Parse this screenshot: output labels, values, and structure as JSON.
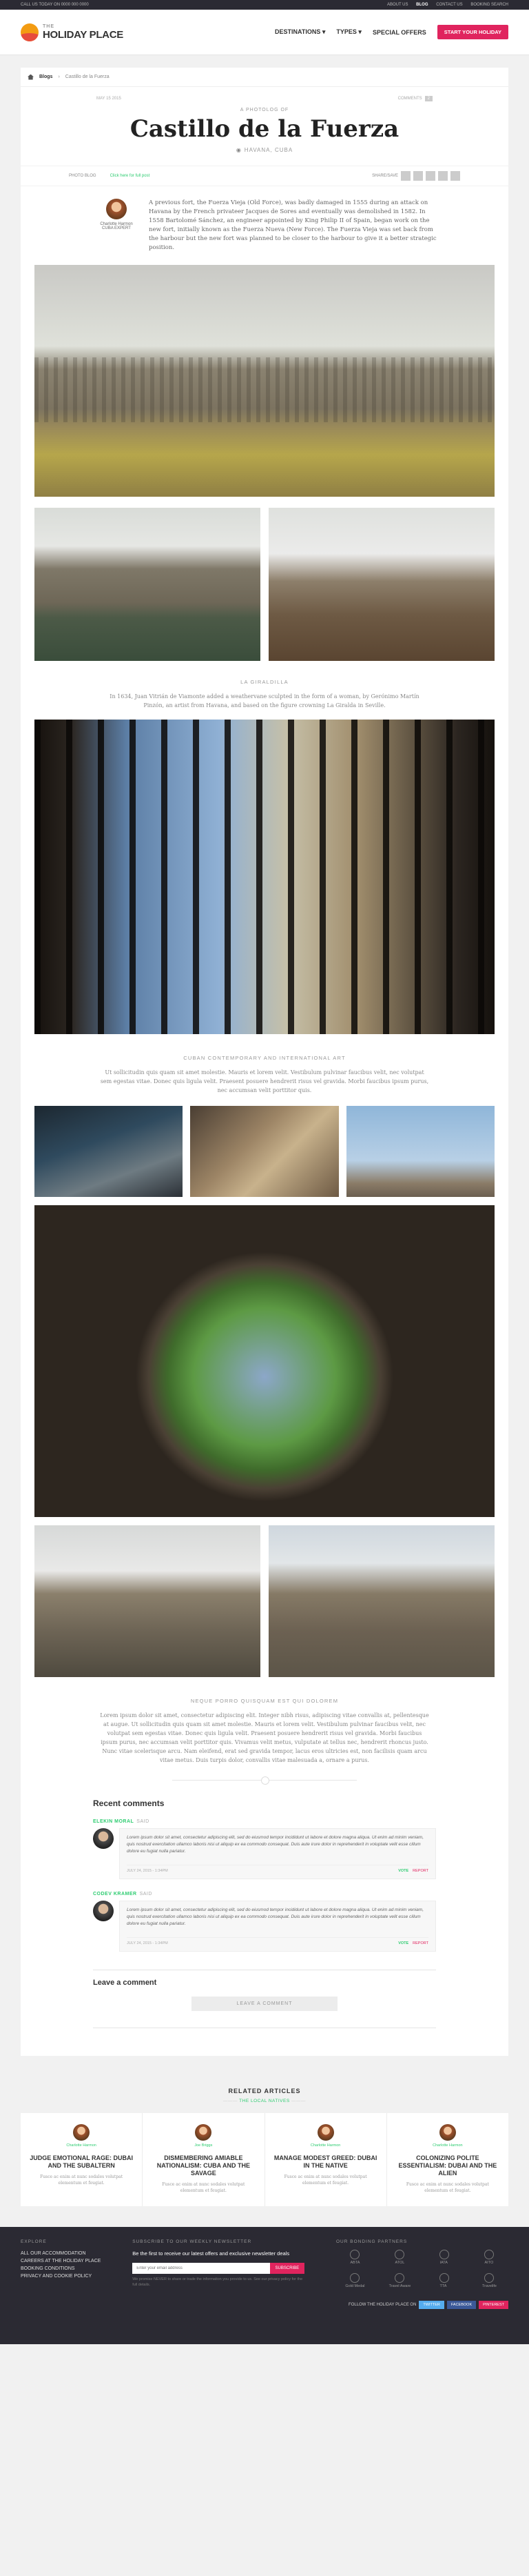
{
  "topbar": {
    "left": "CALL US TODAY ON 0000 000 0000",
    "links": [
      "ABOUT US",
      "BLOG",
      "CONTACT US",
      "BOOKING SEARCH"
    ]
  },
  "header": {
    "logo_main": "HOLIDAY PLACE",
    "logo_the": "THE",
    "nav": [
      "DESTINATIONS",
      "TYPES",
      "SPECIAL OFFERS"
    ],
    "cta": "START YOUR HOLIDAY"
  },
  "breadcrumb": {
    "blogs": "Blogs",
    "current": "Castillo de la Fuerza"
  },
  "article": {
    "date": "MAY 15 2015",
    "comments_label": "COMMENTS",
    "comments_count": "2",
    "kicker": "A PHOTOLOG OF",
    "title": "Castillo de la Fuerza",
    "location": "HAVANA, CUBA",
    "type_label": "PHOTO BLOG",
    "more_link": "Click here for full post",
    "share_label": "SHARE/SAVE",
    "author_name": "Charlotte Harmon",
    "author_role": "CUBA EXPERT",
    "intro": "A previous fort, the Fuerza Vieja (Old Force), was badly damaged in 1555 during an attack on Havana by the French privateer Jacques de Sores and eventually was demolished in 1582. In 1558 Bartolomé Sánchez, an engineer appointed by King Philip II of Spain, began work on the new fort, initially known as the Fuerza Nueva (New Force). The Fuerza Vieja was set back from the harbour but the new fort was planned to be closer to the harbour to give it a better strategic position."
  },
  "sections": [
    {
      "caption": "LA GIRALDILLA",
      "text": "In 1634, Juan Vitrián de Viamonte added a weathervane sculpted in the form of a woman, by Gerónimo Martín Pinzón, an artist from Havana, and based on the figure crowning La Giralda in Seville."
    },
    {
      "caption": "CUBAN CONTEMPORARY AND INTERNATIONAL ART",
      "text": "Ut sollicitudin quis quam sit amet molestie. Mauris et lorem velit. Vestibulum pulvinar faucibus velit, nec volutpat sem egestas vitae. Donec quis ligula velit. Praesent posuere hendrerit risus vel gravida. Morbi faucibus ipsum purus, nec accumsan velit porttitor quis."
    },
    {
      "caption": "NEQUE PORRO QUISQUAM EST QUI DOLOREM",
      "text": "Lorem ipsum dolor sit amet, consectetur adipiscing elit. Integer nibh risus, adipiscing vitae convallis at, pellentesque at augue. Ut sollicitudin quis quam sit amet molestie. Mauris et lorem velit. Vestibulum pulvinar faucibus velit, nec volutpat sem egestas vitae. Donec quis ligula velit. Praesent posuere hendrerit risus vel gravida. Morbi faucibus ipsum purus, nec accumsan velit porttitor quis. Vivamus velit metus, vulputate at tellus nec, hendrerit rhoncus justo. Nunc vitae scelerisque arcu. Nam eleifend, erat sed gravida tempor, lacus eros ultricies est, non facilisis quam arcu vitae metus. Duis turpis dolor, convallis vitae malesuada a, ornare a purus."
    }
  ],
  "comments": {
    "title": "Recent comments",
    "items": [
      {
        "name": "ELEKIN MORAL",
        "when": "SAID",
        "text": "Lorem ipsum dolor sit amet, consectetur adipiscing elit, sed do eiusmod tempor incididunt ut labore et dolore magna aliqua. Ut enim ad minim veniam, quis nostrud exercitation ullamco laboris nisi ut aliquip ex ea commodo consequat. Duis aute irure dolor in reprehenderit in voluptate velit esse cillum dolore eu fugiat nulla pariatur.",
        "date": "JULY 24, 2015 - 1:34PM",
        "up": "VOTE",
        "down": "REPORT"
      },
      {
        "name": "CODEV KRAMER",
        "when": "SAID",
        "text": "Lorem ipsum dolor sit amet, consectetur adipiscing elit, sed do eiusmod tempor incididunt ut labore et dolore magna aliqua. Ut enim ad minim veniam, quis nostrud exercitation ullamco laboris nisi ut aliquip ex ea commodo consequat. Duis aute irure dolor in reprehenderit in voluptate velit esse cillum dolore eu fugiat nulla pariatur.",
        "date": "JULY 24, 2015 - 1:34PM",
        "up": "VOTE",
        "down": "REPORT"
      }
    ]
  },
  "leave": {
    "title": "Leave a comment",
    "button": "LEAVE A COMMENT"
  },
  "related": {
    "title": "RELATED ARTICLES",
    "subtitle": "THE LOCAL NATIVES",
    "items": [
      {
        "by": "Charlotte Harmon",
        "title": "JUDGE EMOTIONAL RAGE: DUBAI AND THE SUBALTERN",
        "desc": "Fusce ac enim at nunc sodales volutpat elementum et feugiat."
      },
      {
        "by": "Joe Briggs",
        "title": "DISMEMBERING AMIABLE NATIONALISM: CUBA AND THE SAVAGE",
        "desc": "Fusce ac enim at nunc sodales volutpat elementum et feugiat."
      },
      {
        "by": "Charlotte Harmon",
        "title": "MANAGE MODEST GREED: DUBAI IN THE NATIVE",
        "desc": "Fusce ac enim at nunc sodales volutpat elementum et feugiat."
      },
      {
        "by": "Charlotte Harmon",
        "title": "COLONIZING POLITE ESSENTIALISM: DUBAI AND THE ALIEN",
        "desc": "Fusce ac enim at nunc sodales volutpat elementum et feugiat."
      }
    ]
  },
  "footer": {
    "explore_title": "EXPLORE",
    "explore_links": [
      "ALL OUR ACCOMMODATION",
      "CAREERS AT THE HOLIDAY PLACE",
      "BOOKING CONDITIONS",
      "PRIVACY AND COOKIE POLICY"
    ],
    "newsletter_title": "SUBSCRIBE TO OUR WEEKLY NEWSLETTER",
    "newsletter_text": "Be the first to receive our latest offers and exclusive newsletter deals",
    "email_placeholder": "Enter your email address",
    "subscribe": "SUBSCRIBE",
    "newsletter_note": "We promise NEVER to share or trade the information you provide to us. See our privacy policy for the full details.",
    "partners_title": "OUR BONDING PARTNERS",
    "partners": [
      "ABTA",
      "ATOL",
      "IATA",
      "AITO",
      "Gold Medal",
      "Travel Aware",
      "TTA",
      "Travelife"
    ],
    "follow": "FOLLOW THE HOLIDAY PLACE ON",
    "social": [
      "TWITTER",
      "FACEBOOK",
      "PINTEREST"
    ]
  }
}
